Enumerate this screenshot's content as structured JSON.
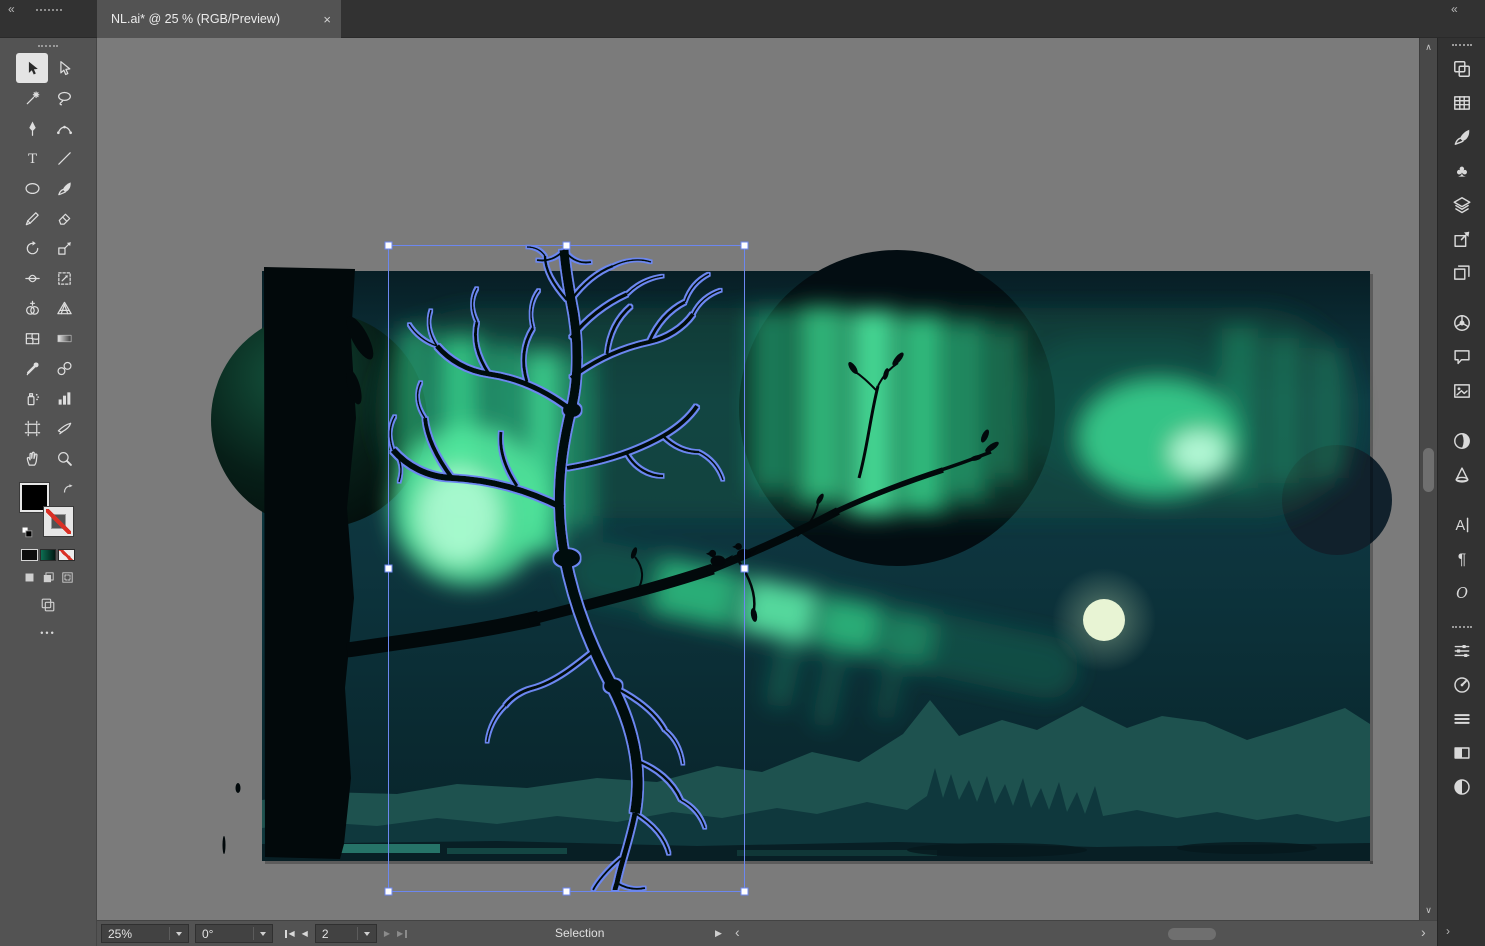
{
  "tab": {
    "title": "NL.ai* @ 25 % (RGB/Preview)",
    "close_glyph": "×"
  },
  "chrome": {
    "collapse_left_glyph": "«",
    "collapse_right_glyph": "«",
    "toolbar_more_glyph": "•••",
    "vscroll_up_glyph": "∧",
    "vscroll_down_glyph": "∨",
    "hscroll_left_glyph": "‹",
    "hscroll_right_glyph": "›",
    "dock_scroll_glyph": "›"
  },
  "toolbox": {
    "fill_color": "#000000",
    "stroke_style": "none",
    "tools": [
      {
        "name": "selection",
        "icon": "arrow-solid",
        "selected": true
      },
      {
        "name": "direct-selection",
        "icon": "arrow-open"
      },
      {
        "name": "magic-wand",
        "icon": "wand"
      },
      {
        "name": "lasso",
        "icon": "lasso"
      },
      {
        "name": "pen",
        "icon": "pen"
      },
      {
        "name": "curvature",
        "icon": "curvature"
      },
      {
        "name": "type",
        "icon": "type"
      },
      {
        "name": "line-segment",
        "icon": "line"
      },
      {
        "name": "ellipse",
        "icon": "ellipse"
      },
      {
        "name": "paintbrush",
        "icon": "brush"
      },
      {
        "name": "pencil",
        "icon": "pencil"
      },
      {
        "name": "eraser",
        "icon": "eraser"
      },
      {
        "name": "rotate",
        "icon": "rotate"
      },
      {
        "name": "scale",
        "icon": "scale"
      },
      {
        "name": "width",
        "icon": "width"
      },
      {
        "name": "free-transform",
        "icon": "free-transform"
      },
      {
        "name": "shape-builder",
        "icon": "shape-builder"
      },
      {
        "name": "perspective-grid",
        "icon": "perspective"
      },
      {
        "name": "mesh",
        "icon": "mesh"
      },
      {
        "name": "gradient",
        "icon": "gradient"
      },
      {
        "name": "eyedropper",
        "icon": "eyedropper"
      },
      {
        "name": "blend",
        "icon": "blend"
      },
      {
        "name": "symbol-sprayer",
        "icon": "spray"
      },
      {
        "name": "column-graph",
        "icon": "graph"
      },
      {
        "name": "artboard",
        "icon": "artboard"
      },
      {
        "name": "slice",
        "icon": "slice"
      },
      {
        "name": "hand",
        "icon": "hand"
      },
      {
        "name": "zoom",
        "icon": "zoom"
      }
    ]
  },
  "rightdock": {
    "groups": [
      {
        "items": [
          {
            "name": "plugins",
            "icon": "overlap-squares"
          },
          {
            "name": "swatches",
            "icon": "swatch-grid"
          },
          {
            "name": "brushes",
            "icon": "brush"
          },
          {
            "name": "symbols",
            "icon": "club"
          },
          {
            "name": "layers",
            "icon": "layers"
          },
          {
            "name": "asset-export",
            "icon": "export"
          },
          {
            "name": "artboards",
            "icon": "artboards"
          }
        ]
      },
      {
        "items": [
          {
            "name": "color",
            "icon": "color-wheel"
          },
          {
            "name": "comments",
            "icon": "comment"
          },
          {
            "name": "links",
            "icon": "image-frame"
          }
        ]
      },
      {
        "items": [
          {
            "name": "color-guide",
            "icon": "ball"
          },
          {
            "name": "materials",
            "icon": "cone"
          }
        ]
      },
      {
        "items": [
          {
            "name": "character",
            "icon": "character"
          },
          {
            "name": "paragraph",
            "icon": "paragraph"
          },
          {
            "name": "opentype",
            "icon": "opentype"
          }
        ]
      },
      {
        "grip": true,
        "items": [
          {
            "name": "properties",
            "icon": "sliders"
          },
          {
            "name": "rotate-view",
            "icon": "dial"
          },
          {
            "name": "align",
            "icon": "lines"
          },
          {
            "name": "gradient-panel",
            "icon": "half-box"
          },
          {
            "name": "transparency",
            "icon": "half-circle"
          }
        ]
      }
    ]
  },
  "statusbar": {
    "zoom_value": "25%",
    "rotation_value": "0°",
    "artboard_value": "2",
    "status_label": "Selection",
    "menu_arrow_glyph": "▶",
    "nav_first_glyph": "◀",
    "nav_prev_glyph": "◀",
    "nav_next_glyph": "▶",
    "nav_last_glyph": "▶"
  },
  "canvas": {
    "selected_object": "tree-branch-group"
  },
  "colors": {
    "chrome_dark": "#323232",
    "panel": "#535353",
    "pasteboard": "#7b7b7b",
    "icon_light": "#d9d9d9",
    "selection_blue": "#6c87f0",
    "aurora_green": "#3bdd91",
    "aurora_bright": "#c2ffdd",
    "night_teal": "#0d3640",
    "moon": "#e8f4d4",
    "silhouette": "#02090b",
    "none_red": "#d93025"
  }
}
